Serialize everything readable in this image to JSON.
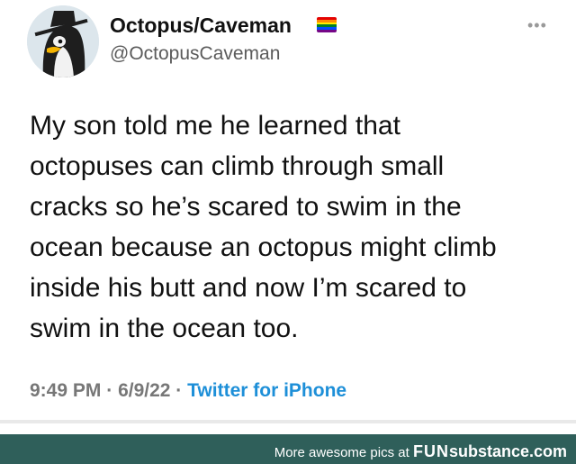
{
  "tweet": {
    "display_name": "Octopus/Caveman",
    "handle": "@OctopusCaveman",
    "more_icon": "ellipsis-icon",
    "flag_colors": [
      "#e40303",
      "#ff8c00",
      "#ffed00",
      "#008026",
      "#004dff",
      "#750787"
    ],
    "text": "My son told me he learned that\noctopuses can climb through small\ncracks so he’s scared to swim in the\nocean because an octopus might climb\ninside his butt and now I’m scared to\nswim in the ocean too.",
    "time": "9:49 PM",
    "date": "6/9/22",
    "separator": "·",
    "source": "Twitter for iPhone"
  },
  "footer": {
    "prefix": "More awesome pics at ",
    "brand_fun": "FUN",
    "brand_rest": "substance.com",
    "background": "#2f5f5a"
  }
}
